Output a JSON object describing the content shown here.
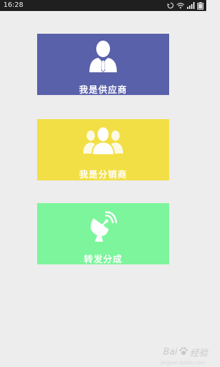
{
  "status_bar": {
    "time": "16:28"
  },
  "tiles": [
    {
      "label": "我是供应商",
      "icon": "supplier-person-icon",
      "color": "#5961aa"
    },
    {
      "label": "我是分销商",
      "icon": "distributor-group-icon",
      "color": "#f2df45"
    },
    {
      "label": "转发分成",
      "icon": "satellite-dish-icon",
      "color": "#7df59c"
    }
  ],
  "watermark": {
    "brand": "Bai",
    "brand_suffix": "经验",
    "sub": "jingyan.baidu.com"
  },
  "colors": {
    "background": "#ededed",
    "status_bar": "#1f1f1f"
  }
}
